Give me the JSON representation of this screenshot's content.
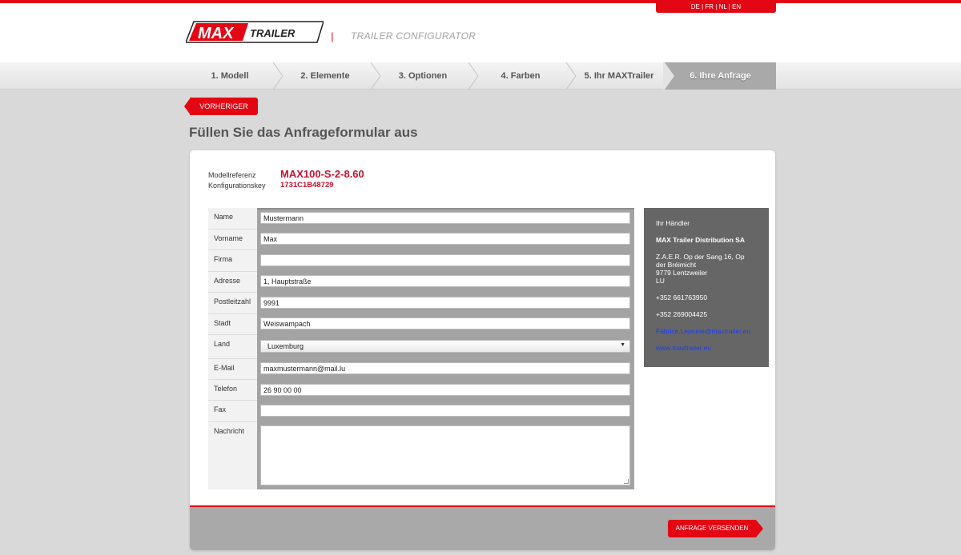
{
  "header": {
    "languages": [
      "DE",
      "FR",
      "NL",
      "EN"
    ],
    "logo_text_max": "MAX",
    "logo_text_trailer": "TRAILER",
    "separator": "|",
    "subtitle": "TRAILER CONFIGURATOR"
  },
  "steps": [
    {
      "label": "1. Modell"
    },
    {
      "label": "2. Elemente"
    },
    {
      "label": "3. Optionen"
    },
    {
      "label": "4. Farben"
    },
    {
      "label": "5. Ihr MAXTrailer"
    },
    {
      "label": "6. Ihre Anfrage"
    }
  ],
  "prev_button": "VORHERIGER",
  "page_title": "Füllen Sie das Anfrageformular aus",
  "reference": {
    "model_label": "Modellreferenz",
    "model_value": "MAX100-S-2-8.60",
    "config_label": "Konfigurationskey",
    "config_value": "1731C1B48729"
  },
  "form": {
    "name": {
      "label": "Name",
      "value": "Mustermann"
    },
    "vorname": {
      "label": "Vorname",
      "value": "Max"
    },
    "firma": {
      "label": "Firma",
      "value": ""
    },
    "adresse": {
      "label": "Adresse",
      "value": "1, Hauptstraße"
    },
    "postleitzahl": {
      "label": "Postleitzahl",
      "value": "9991"
    },
    "stadt": {
      "label": "Stadt",
      "value": "Weiswampach"
    },
    "land": {
      "label": "Land",
      "value": "Luxemburg"
    },
    "email": {
      "label": "E-Mail",
      "value": "maxmustermann@mail.lu"
    },
    "telefon": {
      "label": "Telefon",
      "value": "26 90 00 00"
    },
    "fax": {
      "label": "Fax",
      "value": ""
    },
    "nachricht": {
      "label": "Nachricht",
      "value": ""
    }
  },
  "dealer": {
    "heading": "Ihr Händler",
    "name": "MAX Trailer Distribution SA",
    "address_line1": "Z.A.E.R. Op der Sang 16, Op",
    "address_line2": "der Bréimicht",
    "address_line3": "9779 Lentzweiler",
    "address_line4": "LU",
    "phone1": "+352 661763950",
    "phone2": "+352 269004425",
    "email": "Fabrice.Lejeune@maxtrailer.eu",
    "website": "www.maxtrailer.eu"
  },
  "submit_button": "ANFRAGE VERSENDEN",
  "colors": {
    "accent": "#e30613",
    "reference_text": "#c8102e",
    "dealer_panel": "#666666",
    "footer_band": "#a9a9a9",
    "link": "#1a3cff"
  }
}
